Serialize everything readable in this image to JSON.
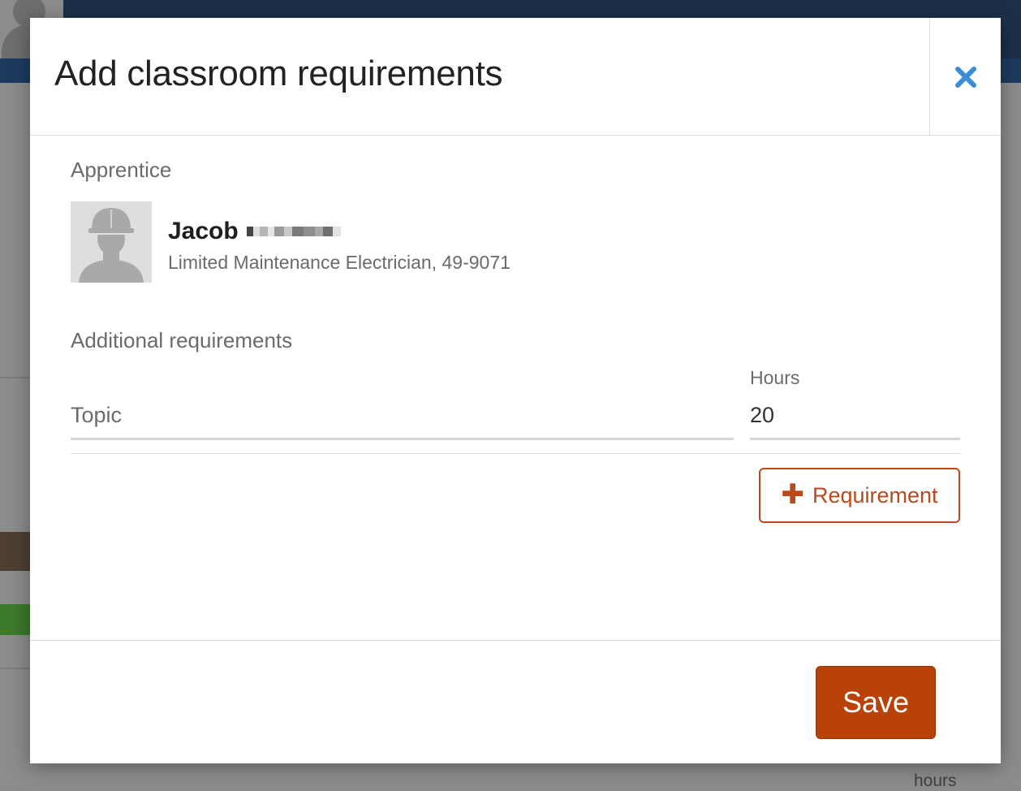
{
  "modal": {
    "title": "Add classroom requirements",
    "close_icon": "close-icon"
  },
  "apprentice": {
    "section_label": "Apprentice",
    "first_name": "Jacob",
    "role": "Limited Maintenance Electrician, 49-9071",
    "avatar_icon": "hard-hat-person-icon"
  },
  "requirements": {
    "section_label": "Additional requirements",
    "topic_placeholder": "Topic",
    "topic_value": "",
    "hours_label": "Hours",
    "hours_value": "20",
    "add_button_label": "Requirement",
    "add_button_icon": "plus-icon"
  },
  "footer": {
    "save_label": "Save"
  },
  "background": {
    "hours_text": "hours"
  },
  "colors": {
    "accent": "#b84208",
    "close": "#3a8cd6",
    "header": "#1c3049"
  }
}
